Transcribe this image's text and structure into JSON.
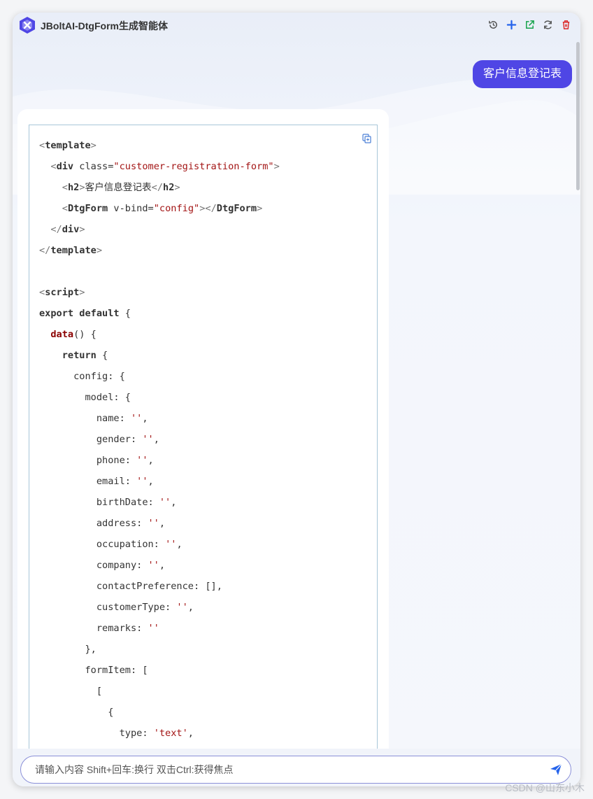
{
  "app": {
    "title": "JBoltAI-DtgForm生成智能体"
  },
  "toolbar": {
    "icons": [
      "history-icon",
      "plus-icon",
      "external-link-icon",
      "refresh-icon",
      "trash-icon"
    ],
    "colors": {
      "history": "#555555",
      "plus": "#2563eb",
      "external": "#16a34a",
      "refresh": "#555555",
      "trash": "#dc2626"
    }
  },
  "chat": {
    "user_message": "客户信息登记表",
    "user_bubble_color": "#4f46e5"
  },
  "code": {
    "lines": [
      [
        [
          "tag",
          "<"
        ],
        [
          "kw",
          "template"
        ],
        [
          "tag",
          ">"
        ]
      ],
      [
        [
          "p",
          "  "
        ],
        [
          "tag",
          "<"
        ],
        [
          "kw",
          "div"
        ],
        [
          "p",
          " class="
        ],
        [
          "str",
          "\"customer-registration-form\""
        ],
        [
          "tag",
          ">"
        ]
      ],
      [
        [
          "p",
          "    "
        ],
        [
          "tag",
          "<"
        ],
        [
          "kw",
          "h2"
        ],
        [
          "tag",
          ">"
        ],
        [
          "p",
          "客户信息登记表"
        ],
        [
          "tag",
          "</"
        ],
        [
          "kw",
          "h2"
        ],
        [
          "tag",
          ">"
        ]
      ],
      [
        [
          "p",
          "    "
        ],
        [
          "tag",
          "<"
        ],
        [
          "kw",
          "DtgForm"
        ],
        [
          "p",
          " v-bind="
        ],
        [
          "str",
          "\"config\""
        ],
        [
          "tag",
          "></"
        ],
        [
          "kw",
          "DtgForm"
        ],
        [
          "tag",
          ">"
        ]
      ],
      [
        [
          "p",
          "  "
        ],
        [
          "tag",
          "</"
        ],
        [
          "kw",
          "div"
        ],
        [
          "tag",
          ">"
        ]
      ],
      [
        [
          "tag",
          "</"
        ],
        [
          "kw",
          "template"
        ],
        [
          "tag",
          ">"
        ]
      ],
      [
        [
          "p",
          ""
        ]
      ],
      [
        [
          "tag",
          "<"
        ],
        [
          "kw",
          "script"
        ],
        [
          "tag",
          ">"
        ]
      ],
      [
        [
          "kw",
          "export default"
        ],
        [
          "p",
          " {"
        ]
      ],
      [
        [
          "p",
          "  "
        ],
        [
          "fn",
          "data"
        ],
        [
          "p",
          "() {"
        ]
      ],
      [
        [
          "p",
          "    "
        ],
        [
          "kw",
          "return"
        ],
        [
          "p",
          " {"
        ]
      ],
      [
        [
          "p",
          "      config: {"
        ]
      ],
      [
        [
          "p",
          "        model: {"
        ]
      ],
      [
        [
          "p",
          "          name: "
        ],
        [
          "str",
          "''"
        ],
        [
          "p",
          ","
        ]
      ],
      [
        [
          "p",
          "          gender: "
        ],
        [
          "str",
          "''"
        ],
        [
          "p",
          ","
        ]
      ],
      [
        [
          "p",
          "          phone: "
        ],
        [
          "str",
          "''"
        ],
        [
          "p",
          ","
        ]
      ],
      [
        [
          "p",
          "          email: "
        ],
        [
          "str",
          "''"
        ],
        [
          "p",
          ","
        ]
      ],
      [
        [
          "p",
          "          birthDate: "
        ],
        [
          "str",
          "''"
        ],
        [
          "p",
          ","
        ]
      ],
      [
        [
          "p",
          "          address: "
        ],
        [
          "str",
          "''"
        ],
        [
          "p",
          ","
        ]
      ],
      [
        [
          "p",
          "          occupation: "
        ],
        [
          "str",
          "''"
        ],
        [
          "p",
          ","
        ]
      ],
      [
        [
          "p",
          "          company: "
        ],
        [
          "str",
          "''"
        ],
        [
          "p",
          ","
        ]
      ],
      [
        [
          "p",
          "          contactPreference: [],"
        ]
      ],
      [
        [
          "p",
          "          customerType: "
        ],
        [
          "str",
          "''"
        ],
        [
          "p",
          ","
        ]
      ],
      [
        [
          "p",
          "          remarks: "
        ],
        [
          "str",
          "''"
        ]
      ],
      [
        [
          "p",
          "        },"
        ]
      ],
      [
        [
          "p",
          "        formItem: ["
        ]
      ],
      [
        [
          "p",
          "          ["
        ]
      ],
      [
        [
          "p",
          "            {"
        ]
      ],
      [
        [
          "p",
          "              type: "
        ],
        [
          "str",
          "'text'"
        ],
        [
          "p",
          ","
        ]
      ]
    ]
  },
  "input": {
    "placeholder": "请输入内容 Shift+回车:换行 双击Ctrl:获得焦点",
    "value": ""
  },
  "watermark": {
    "text": "CSDN @山东小木"
  }
}
